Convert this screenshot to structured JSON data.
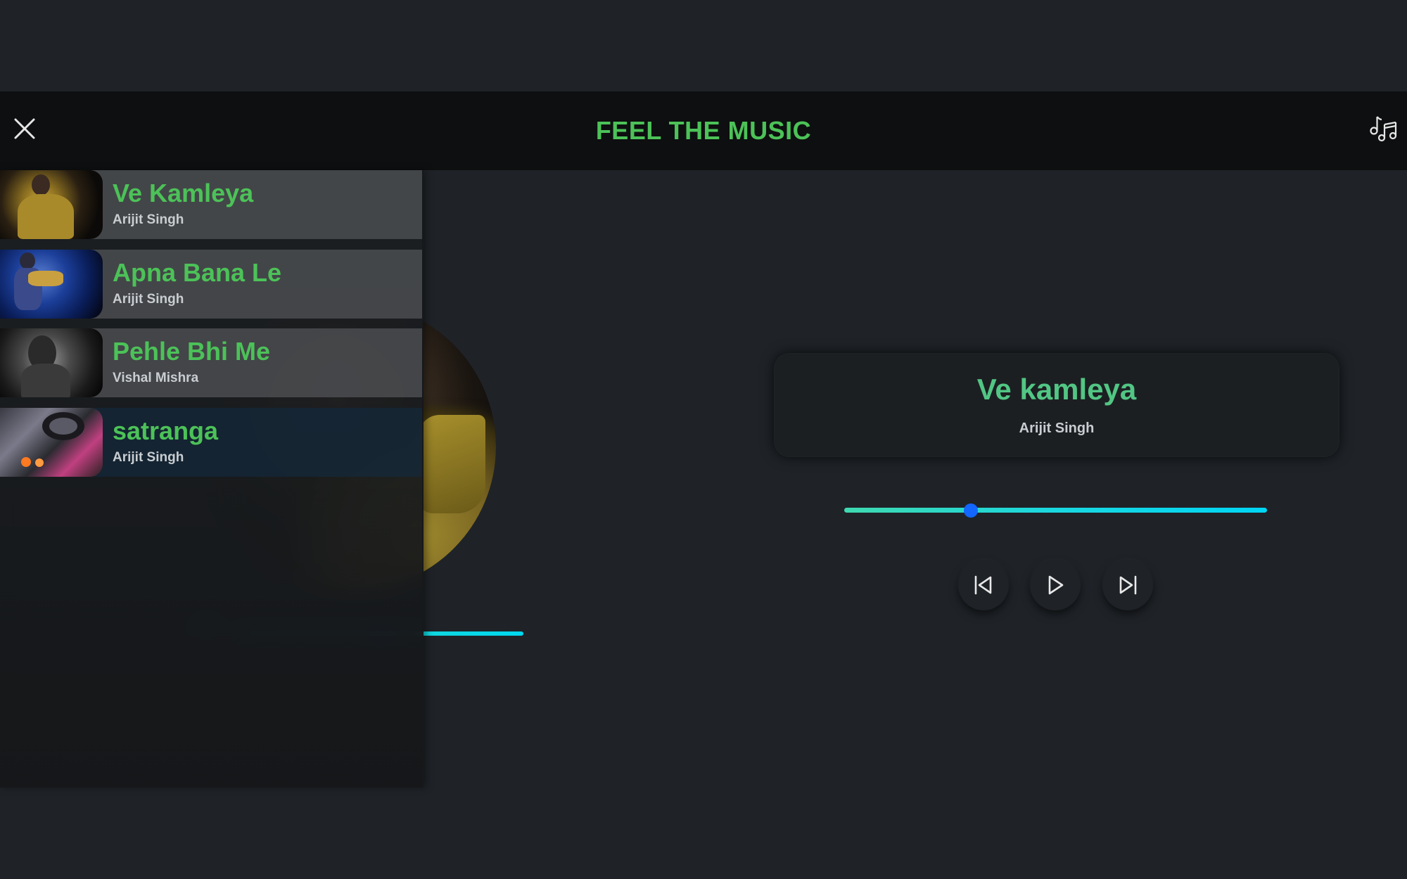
{
  "app": {
    "title": "FEEL THE MUSIC"
  },
  "header": {
    "close_icon": "close-icon",
    "playlist_icon": "music-notes-icon"
  },
  "playlist": {
    "items": [
      {
        "title": "Ve Kamleya",
        "artist": "Arijit Singh",
        "active": false
      },
      {
        "title": "Apna Bana Le",
        "artist": "Arijit Singh",
        "active": false
      },
      {
        "title": "Pehle Bhi Me",
        "artist": "Vishal Mishra",
        "active": false
      },
      {
        "title": "satranga",
        "artist": "Arijit Singh",
        "active": true
      }
    ]
  },
  "now_playing": {
    "title": "Ve kamleya",
    "artist": "Arijit Singh",
    "progress_fraction": 0.3
  },
  "controls": {
    "previous_icon": "skip-previous-icon",
    "play_icon": "play-icon",
    "next_icon": "skip-next-icon"
  },
  "colors": {
    "accent_green": "#4cc258",
    "progress_start": "#3fd9b0",
    "progress_end": "#00d6f5",
    "knob": "#1366ff",
    "background": "#1f2328",
    "header_bg": "#0e0f10"
  }
}
